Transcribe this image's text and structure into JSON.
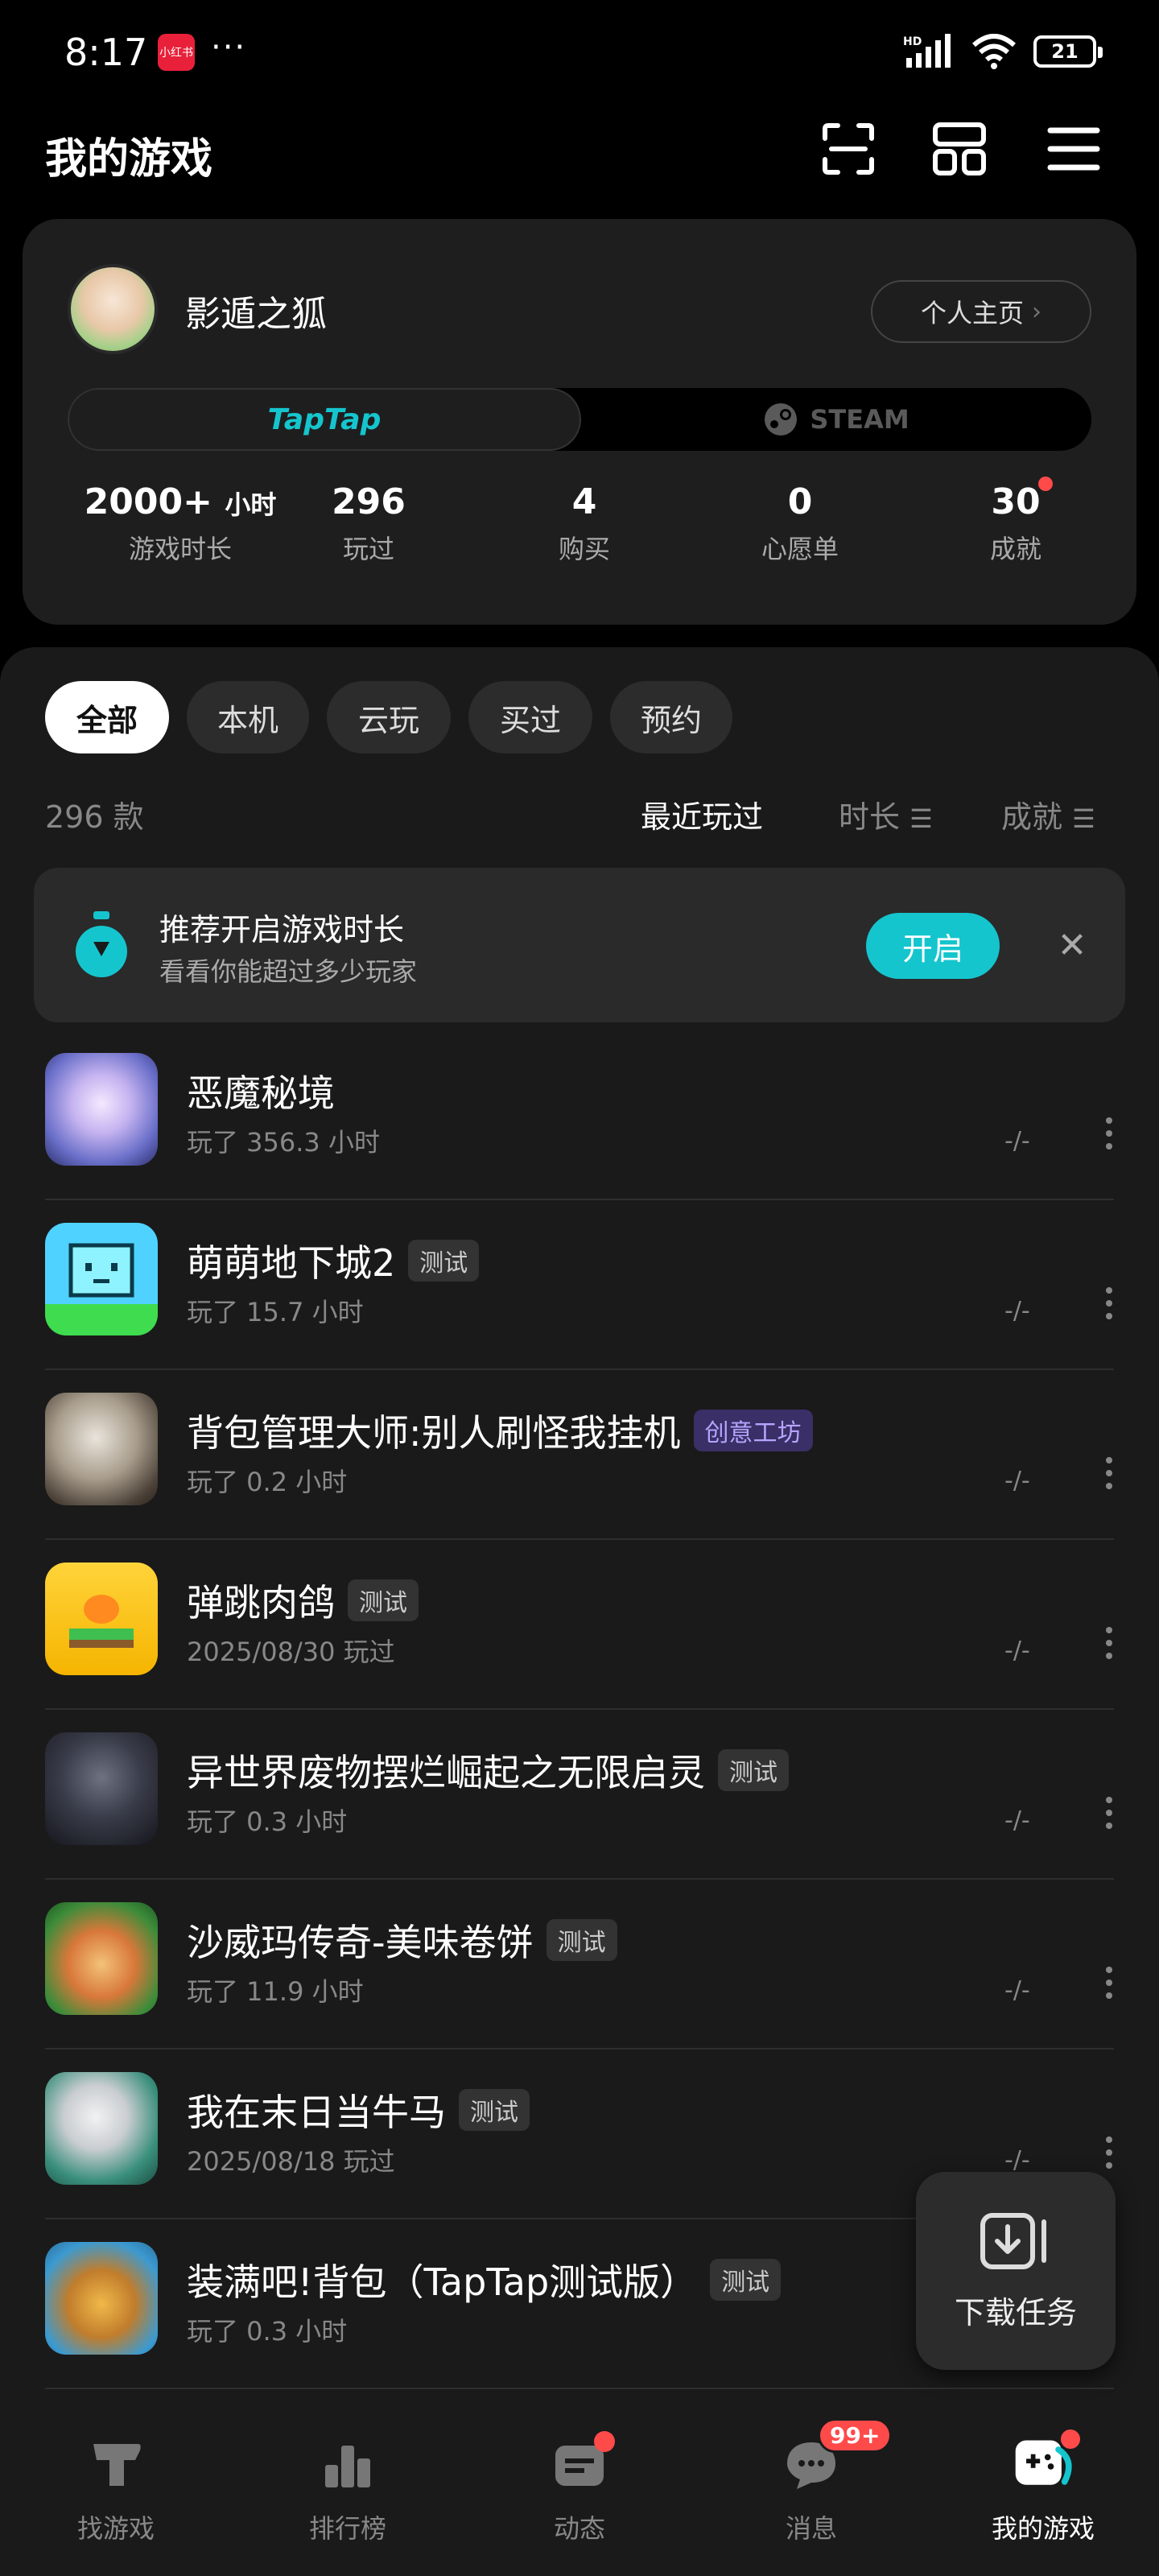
{
  "status_bar": {
    "time": "8:17",
    "app_badge": "小红书",
    "dots": "···",
    "network": "HD",
    "battery": "21"
  },
  "header": {
    "title": "我的游戏",
    "icons": [
      "scan-icon",
      "grid-icon",
      "menu-icon"
    ]
  },
  "profile": {
    "username": "影遁之狐",
    "home_button": "个人主页",
    "platforms": [
      "TapTap",
      "STEAM"
    ],
    "stats": [
      {
        "value": "2000+",
        "unit": "小时",
        "label": "游戏时长"
      },
      {
        "value": "296",
        "unit": "",
        "label": "玩过"
      },
      {
        "value": "4",
        "unit": "",
        "label": "购买"
      },
      {
        "value": "0",
        "unit": "",
        "label": "心愿单"
      },
      {
        "value": "30",
        "unit": "",
        "label": "成就"
      }
    ]
  },
  "filters": [
    "全部",
    "本机",
    "云玩",
    "买过",
    "预约"
  ],
  "count_text": "296 款",
  "sort": [
    "最近玩过",
    "时长",
    "成就"
  ],
  "recommend": {
    "title": "推荐开启游戏时长",
    "subtitle": "看看你能超过多少玩家",
    "button": "开启"
  },
  "games": [
    {
      "title": "恶魔秘境",
      "tag": "",
      "sub": "玩了 356.3 小时",
      "score": "-/-"
    },
    {
      "title": "萌萌地下城2",
      "tag": "测试",
      "sub": "玩了 15.7 小时",
      "score": "-/-"
    },
    {
      "title": "背包管理大师:别人刷怪我挂机",
      "tag": "创意工坊",
      "sub": "玩了 0.2 小时",
      "score": "-/-"
    },
    {
      "title": "弹跳肉鸽",
      "tag": "测试",
      "sub": "2025/08/30 玩过",
      "score": "-/-"
    },
    {
      "title": "异世界废物摆烂崛起之无限启灵",
      "tag": "测试",
      "sub": "玩了 0.3 小时",
      "score": "-/-"
    },
    {
      "title": "沙威玛传奇-美味卷饼",
      "tag": "测试",
      "sub": "玩了 11.9 小时",
      "score": "-/-"
    },
    {
      "title": "我在末日当牛马",
      "tag": "测试",
      "sub": "2025/08/18 玩过",
      "score": "-/-"
    },
    {
      "title": "装满吧!背包（TapTap测试版）",
      "tag": "测试",
      "sub": "玩了 0.3 小时",
      "score": ""
    }
  ],
  "download": {
    "label": "下载任务"
  },
  "nav": [
    {
      "label": "找游戏",
      "icon": "find-games-icon"
    },
    {
      "label": "排行榜",
      "icon": "ranking-icon"
    },
    {
      "label": "动态",
      "icon": "feed-icon"
    },
    {
      "label": "消息",
      "icon": "message-icon",
      "badge": "99+"
    },
    {
      "label": "我的游戏",
      "icon": "my-games-icon"
    }
  ],
  "colors": {
    "accent": "#15c5ce",
    "badge": "#ff4a4a",
    "background": "#000000",
    "panel": "#1a1a1a"
  }
}
